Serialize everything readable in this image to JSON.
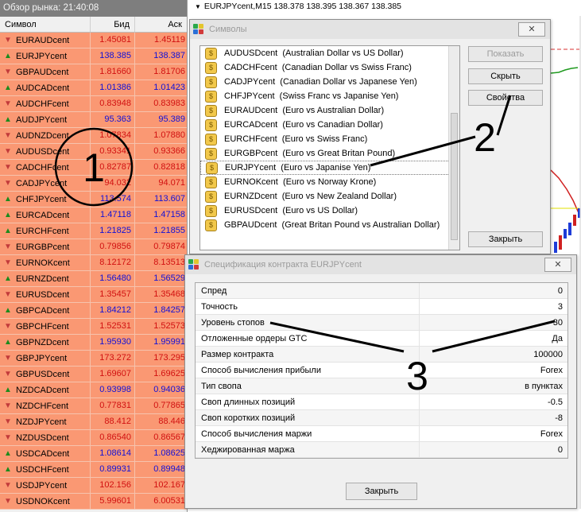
{
  "market_watch": {
    "title": "Обзор рынка: 21:40:08",
    "columns": {
      "symbol": "Символ",
      "bid": "Бид",
      "ask": "Аск"
    },
    "rows": [
      {
        "symbol": "EURAUDcent",
        "dir": "down",
        "bid": "1.45081",
        "ask": "1.45119",
        "color": "red"
      },
      {
        "symbol": "EURJPYcent",
        "dir": "up",
        "bid": "138.385",
        "ask": "138.387",
        "color": "blue"
      },
      {
        "symbol": "GBPAUDcent",
        "dir": "down",
        "bid": "1.81660",
        "ask": "1.81706",
        "color": "red"
      },
      {
        "symbol": "AUDCADcent",
        "dir": "up",
        "bid": "1.01386",
        "ask": "1.01423",
        "color": "blue"
      },
      {
        "symbol": "AUDCHFcent",
        "dir": "down",
        "bid": "0.83948",
        "ask": "0.83983",
        "color": "red"
      },
      {
        "symbol": "AUDJPYcent",
        "dir": "up",
        "bid": "95.363",
        "ask": "95.389",
        "color": "blue"
      },
      {
        "symbol": "AUDNZDcent",
        "dir": "down",
        "bid": "1.07834",
        "ask": "1.07880",
        "color": "red"
      },
      {
        "symbol": "AUDUSDcent",
        "dir": "down",
        "bid": "0.93341",
        "ask": "0.93366",
        "color": "red"
      },
      {
        "symbol": "CADCHFcent",
        "dir": "down",
        "bid": "0.82787",
        "ask": "0.82818",
        "color": "red"
      },
      {
        "symbol": "CADJPYcent",
        "dir": "down",
        "bid": "94.032",
        "ask": "94.071",
        "color": "red"
      },
      {
        "symbol": "CHFJPYcent",
        "dir": "up",
        "bid": "113.574",
        "ask": "113.607",
        "color": "blue"
      },
      {
        "symbol": "EURCADcent",
        "dir": "up",
        "bid": "1.47118",
        "ask": "1.47158",
        "color": "blue"
      },
      {
        "symbol": "EURCHFcent",
        "dir": "up",
        "bid": "1.21825",
        "ask": "1.21855",
        "color": "blue"
      },
      {
        "symbol": "EURGBPcent",
        "dir": "down",
        "bid": "0.79856",
        "ask": "0.79874",
        "color": "red"
      },
      {
        "symbol": "EURNOKcent",
        "dir": "down",
        "bid": "8.12172",
        "ask": "8.13513",
        "color": "red"
      },
      {
        "symbol": "EURNZDcent",
        "dir": "up",
        "bid": "1.56480",
        "ask": "1.56529",
        "color": "blue"
      },
      {
        "symbol": "EURUSDcent",
        "dir": "down",
        "bid": "1.35457",
        "ask": "1.35468",
        "color": "red"
      },
      {
        "symbol": "GBPCADcent",
        "dir": "up",
        "bid": "1.84212",
        "ask": "1.84257",
        "color": "blue"
      },
      {
        "symbol": "GBPCHFcent",
        "dir": "down",
        "bid": "1.52531",
        "ask": "1.52573",
        "color": "red"
      },
      {
        "symbol": "GBPNZDcent",
        "dir": "up",
        "bid": "1.95930",
        "ask": "1.95991",
        "color": "blue"
      },
      {
        "symbol": "GBPJPYcent",
        "dir": "down",
        "bid": "173.272",
        "ask": "173.295",
        "color": "red"
      },
      {
        "symbol": "GBPUSDcent",
        "dir": "down",
        "bid": "1.69607",
        "ask": "1.69625",
        "color": "red"
      },
      {
        "symbol": "NZDCADcent",
        "dir": "up",
        "bid": "0.93998",
        "ask": "0.94036",
        "color": "blue"
      },
      {
        "symbol": "NZDCHFcent",
        "dir": "down",
        "bid": "0.77831",
        "ask": "0.77865",
        "color": "red"
      },
      {
        "symbol": "NZDJPYcent",
        "dir": "down",
        "bid": "88.412",
        "ask": "88.446",
        "color": "red"
      },
      {
        "symbol": "NZDUSDcent",
        "dir": "down",
        "bid": "0.86540",
        "ask": "0.86567",
        "color": "red"
      },
      {
        "symbol": "USDCADcent",
        "dir": "up",
        "bid": "1.08614",
        "ask": "1.08625",
        "color": "blue"
      },
      {
        "symbol": "USDCHFcent",
        "dir": "up",
        "bid": "0.89931",
        "ask": "0.89948",
        "color": "blue"
      },
      {
        "symbol": "USDJPYcent",
        "dir": "down",
        "bid": "102.156",
        "ask": "102.167",
        "color": "red"
      },
      {
        "symbol": "USDNOKcent",
        "dir": "down",
        "bid": "5.99601",
        "ask": "6.00531",
        "color": "red"
      }
    ]
  },
  "chart": {
    "header": "EURJPYcent,M15  138.378 138.395 138.367 138.385"
  },
  "symbols_dialog": {
    "title": "Символы",
    "items": [
      "AUDUSDcent  (Australian Dollar vs US Dollar)",
      "CADCHFcent  (Canadian Dollar vs Swiss Franc)",
      "CADJPYcent  (Canadian Dollar vs Japanese Yen)",
      "CHFJPYcent  (Swiss Franc vs Japanise Yen)",
      "EURAUDcent  (Euro vs Australian Dollar)",
      "EURCADcent  (Euro vs Canadian Dollar)",
      "EURCHFcent  (Euro vs Swiss Franc)",
      "EURGBPcent  (Euro vs Great Britan Pound)",
      "EURJPYcent  (Euro vs Japanise Yen)",
      "EURNOKcent  (Euro vs Norway Krone)",
      "EURNZDcent  (Euro vs New Zealand Dollar)",
      "EURUSDcent  (Euro vs US Dollar)",
      "GBPAUDcent  (Great Britan Pound vs Australian Dollar)"
    ],
    "selected_index": 8,
    "buttons": {
      "show": "Показать",
      "hide": "Скрыть",
      "properties": "Свойства",
      "close": "Закрыть"
    }
  },
  "spec_dialog": {
    "title": "Спецификация контракта EURJPYcent",
    "rows": [
      {
        "k": "Спред",
        "v": "0"
      },
      {
        "k": "Точность",
        "v": "3"
      },
      {
        "k": "Уровень стопов",
        "v": "30"
      },
      {
        "k": "Отложенные ордеры GTC",
        "v": "Да"
      },
      {
        "k": "Размер контракта",
        "v": "100000"
      },
      {
        "k": "Способ вычисления прибыли",
        "v": "Forex"
      },
      {
        "k": "Тип свопа",
        "v": "в пунктах"
      },
      {
        "k": "Своп длинных позиций",
        "v": "-0.5"
      },
      {
        "k": "Своп коротких позиций",
        "v": "-8"
      },
      {
        "k": "Способ вычисления маржи",
        "v": "Forex"
      },
      {
        "k": "Хеджированная маржа",
        "v": "0"
      }
    ],
    "close_label": "Закрыть"
  },
  "annotations": {
    "one": "1",
    "two": "2",
    "three": "3"
  },
  "icons": {
    "up": "arrow-up-icon",
    "down": "arrow-down-icon",
    "coin": "coin-icon",
    "app": "app-icon"
  },
  "colors": {
    "row_bg": "#fa9873",
    "bid_red": "#d11010",
    "bid_blue": "#1010d8"
  }
}
